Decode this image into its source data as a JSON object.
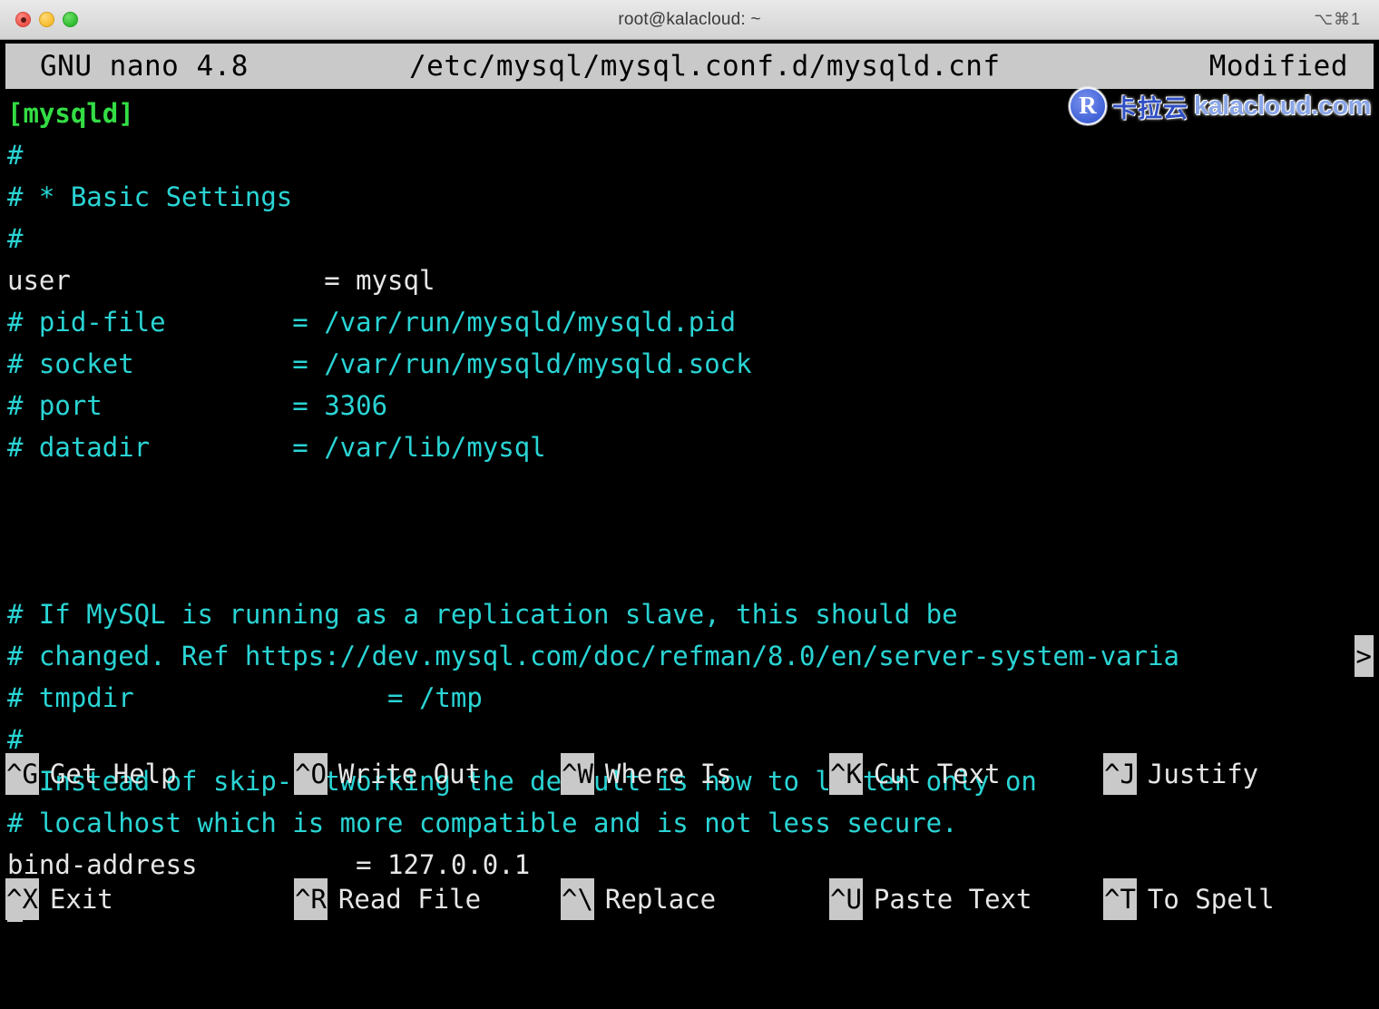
{
  "window": {
    "title": "root@kalacloud: ~",
    "shortcut": "⌥⌘1",
    "controls": {
      "close": "close",
      "minimize": "minimize",
      "zoom": "zoom"
    }
  },
  "nano": {
    "version": "GNU nano 4.8",
    "filename": "/etc/mysql/mysql.conf.d/mysqld.cnf",
    "modified": "Modified"
  },
  "watermark": {
    "logo_letter": "R",
    "cn": "卡拉云",
    "en": "kalacloud.com"
  },
  "colors": {
    "section": "#33dd44",
    "comment": "#2ad4d4",
    "value": "#e6e6e6",
    "background": "#000000",
    "inverted_bg": "#c9c9c9"
  },
  "editor": {
    "continuation_marker": ">",
    "cursor": "block",
    "lines": [
      {
        "type": "section",
        "text": "[mysqld]"
      },
      {
        "type": "comment",
        "text": "#"
      },
      {
        "type": "comment",
        "text": "# * Basic Settings"
      },
      {
        "type": "comment",
        "text": "#"
      },
      {
        "type": "setting",
        "key": "user",
        "eq": "=",
        "value": "mysql"
      },
      {
        "type": "comment",
        "text": "# pid-file        = /var/run/mysqld/mysqld.pid"
      },
      {
        "type": "comment",
        "text": "# socket          = /var/run/mysqld/mysqld.sock"
      },
      {
        "type": "comment",
        "text": "# port            = 3306"
      },
      {
        "type": "comment",
        "text": "# datadir         = /var/lib/mysql"
      },
      {
        "type": "blank",
        "text": ""
      },
      {
        "type": "blank",
        "text": ""
      },
      {
        "type": "blank",
        "text": ""
      },
      {
        "type": "comment",
        "text": "# If MySQL is running as a replication slave, this should be"
      },
      {
        "type": "comment-wrapped",
        "text": "# changed. Ref https://dev.mysql.com/doc/refman/8.0/en/server-system-varia"
      },
      {
        "type": "comment",
        "text": "# tmpdir                = /tmp"
      },
      {
        "type": "comment",
        "text": "#"
      },
      {
        "type": "comment",
        "text": "# Instead of skip-networking the default is now to listen only on"
      },
      {
        "type": "comment",
        "text": "# localhost which is more compatible and is not less secure."
      },
      {
        "type": "setting",
        "key": "bind-address",
        "eq": "=",
        "value": "127.0.0.1",
        "pad": 22
      },
      {
        "type": "cursor",
        "text": ""
      }
    ]
  },
  "shortcuts": {
    "row1": [
      {
        "key": "^G",
        "label": "Get Help"
      },
      {
        "key": "^O",
        "label": "Write Out"
      },
      {
        "key": "^W",
        "label": "Where Is"
      },
      {
        "key": "^K",
        "label": "Cut Text"
      },
      {
        "key": "^J",
        "label": "Justify"
      }
    ],
    "row2": [
      {
        "key": "^X",
        "label": "Exit"
      },
      {
        "key": "^R",
        "label": "Read File"
      },
      {
        "key": "^\\",
        "label": "Replace"
      },
      {
        "key": "^U",
        "label": "Paste Text"
      },
      {
        "key": "^T",
        "label": "To Spell"
      }
    ]
  }
}
